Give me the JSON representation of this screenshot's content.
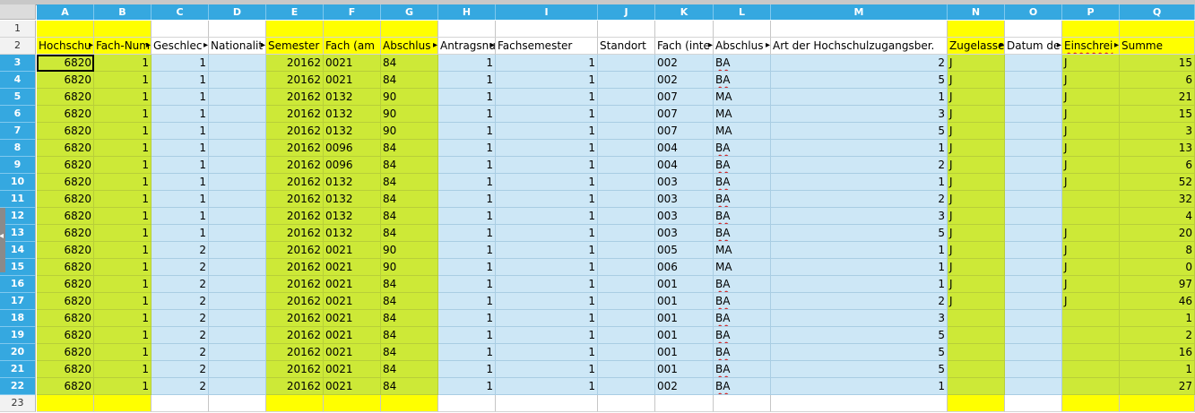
{
  "app": "Spreadsheet",
  "columns": [
    "A",
    "B",
    "C",
    "D",
    "E",
    "F",
    "G",
    "H",
    "I",
    "J",
    "K",
    "L",
    "M",
    "N",
    "O",
    "P",
    "Q"
  ],
  "header_row": {
    "row_label": "2",
    "cells": [
      "Hochschu",
      "Fach-Num",
      "Geschlec",
      "Nationalit",
      "Semester",
      "Fach (am",
      "Abschlus",
      "Antragsnu",
      "Fachsemester",
      "Standort",
      "Fach (inte",
      "Abschlus",
      "Art der Hochschulzugangsber.",
      "Zugelasse",
      "Datum de",
      "Einschrei",
      "Summe"
    ]
  },
  "empty_rows": {
    "first": "1",
    "last": "23"
  },
  "active_cell": "A3",
  "rows": [
    {
      "label": "3",
      "cells": [
        "6820",
        "1",
        "1",
        "",
        "20162",
        "0021",
        "84",
        "1",
        "1",
        "",
        "002",
        "BA",
        "2",
        "J",
        "",
        "J",
        "15"
      ]
    },
    {
      "label": "4",
      "cells": [
        "6820",
        "1",
        "1",
        "",
        "20162",
        "0021",
        "84",
        "1",
        "1",
        "",
        "002",
        "BA",
        "5",
        "J",
        "",
        "J",
        "6"
      ]
    },
    {
      "label": "5",
      "cells": [
        "6820",
        "1",
        "1",
        "",
        "20162",
        "0132",
        "90",
        "1",
        "1",
        "",
        "007",
        "MA",
        "1",
        "J",
        "",
        "J",
        "21"
      ]
    },
    {
      "label": "6",
      "cells": [
        "6820",
        "1",
        "1",
        "",
        "20162",
        "0132",
        "90",
        "1",
        "1",
        "",
        "007",
        "MA",
        "3",
        "J",
        "",
        "J",
        "15"
      ]
    },
    {
      "label": "7",
      "cells": [
        "6820",
        "1",
        "1",
        "",
        "20162",
        "0132",
        "90",
        "1",
        "1",
        "",
        "007",
        "MA",
        "5",
        "J",
        "",
        "J",
        "3"
      ]
    },
    {
      "label": "8",
      "cells": [
        "6820",
        "1",
        "1",
        "",
        "20162",
        "0096",
        "84",
        "1",
        "1",
        "",
        "004",
        "BA",
        "1",
        "J",
        "",
        "J",
        "13"
      ]
    },
    {
      "label": "9",
      "cells": [
        "6820",
        "1",
        "1",
        "",
        "20162",
        "0096",
        "84",
        "1",
        "1",
        "",
        "004",
        "BA",
        "2",
        "J",
        "",
        "J",
        "6"
      ]
    },
    {
      "label": "10",
      "cells": [
        "6820",
        "1",
        "1",
        "",
        "20162",
        "0132",
        "84",
        "1",
        "1",
        "",
        "003",
        "BA",
        "1",
        "J",
        "",
        "J",
        "52"
      ]
    },
    {
      "label": "11",
      "cells": [
        "6820",
        "1",
        "1",
        "",
        "20162",
        "0132",
        "84",
        "1",
        "1",
        "",
        "003",
        "BA",
        "2",
        "J",
        "",
        "",
        "32"
      ]
    },
    {
      "label": "12",
      "cells": [
        "6820",
        "1",
        "1",
        "",
        "20162",
        "0132",
        "84",
        "1",
        "1",
        "",
        "003",
        "BA",
        "3",
        "J",
        "",
        "",
        "4"
      ]
    },
    {
      "label": "13",
      "cells": [
        "6820",
        "1",
        "1",
        "",
        "20162",
        "0132",
        "84",
        "1",
        "1",
        "",
        "003",
        "BA",
        "5",
        "J",
        "",
        "J",
        "20"
      ]
    },
    {
      "label": "14",
      "cells": [
        "6820",
        "1",
        "2",
        "",
        "20162",
        "0021",
        "90",
        "1",
        "1",
        "",
        "005",
        "MA",
        "1",
        "J",
        "",
        "J",
        "8"
      ]
    },
    {
      "label": "15",
      "cells": [
        "6820",
        "1",
        "2",
        "",
        "20162",
        "0021",
        "90",
        "1",
        "1",
        "",
        "006",
        "MA",
        "1",
        "J",
        "",
        "J",
        "0"
      ]
    },
    {
      "label": "16",
      "cells": [
        "6820",
        "1",
        "2",
        "",
        "20162",
        "0021",
        "84",
        "1",
        "1",
        "",
        "001",
        "BA",
        "1",
        "J",
        "",
        "J",
        "97"
      ]
    },
    {
      "label": "17",
      "cells": [
        "6820",
        "1",
        "2",
        "",
        "20162",
        "0021",
        "84",
        "1",
        "1",
        "",
        "001",
        "BA",
        "2",
        "J",
        "",
        "J",
        "46"
      ]
    },
    {
      "label": "18",
      "cells": [
        "6820",
        "1",
        "2",
        "",
        "20162",
        "0021",
        "84",
        "1",
        "1",
        "",
        "001",
        "BA",
        "3",
        "",
        "",
        "",
        "1"
      ]
    },
    {
      "label": "19",
      "cells": [
        "6820",
        "1",
        "2",
        "",
        "20162",
        "0021",
        "84",
        "1",
        "1",
        "",
        "001",
        "BA",
        "5",
        "",
        "",
        "",
        "2"
      ]
    },
    {
      "label": "20",
      "cells": [
        "6820",
        "1",
        "2",
        "",
        "20162",
        "0021",
        "84",
        "1",
        "1",
        "",
        "001",
        "BA",
        "5",
        "",
        "",
        "",
        "16"
      ]
    },
    {
      "label": "21",
      "cells": [
        "6820",
        "1",
        "2",
        "",
        "20162",
        "0021",
        "84",
        "1",
        "1",
        "",
        "001",
        "BA",
        "5",
        "",
        "",
        "",
        "1"
      ]
    },
    {
      "label": "22",
      "cells": [
        "6820",
        "1",
        "2",
        "",
        "20162",
        "0021",
        "84",
        "1",
        "1",
        "",
        "002",
        "BA",
        "1",
        "",
        "",
        "",
        "27"
      ]
    }
  ],
  "colors": {
    "header_yellow": "#ffff00",
    "data_green": "#cde937",
    "data_blue": "#cde7f6",
    "column_header_blue": "#35a8e0"
  }
}
